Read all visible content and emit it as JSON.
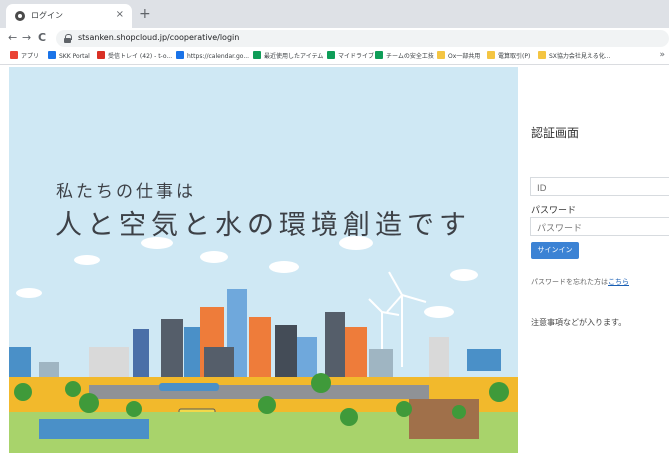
{
  "tab": {
    "title": "ログイン",
    "close": "×",
    "new_tab": "+"
  },
  "toolbar": {
    "back": "←",
    "forward": "→",
    "reload": "C",
    "url": "stsanken.shopcloud.jp/cooperative/login"
  },
  "bookmarks": [
    {
      "label": "アプリ",
      "icon": "apps-grid-icon",
      "color": "#ea4335"
    },
    {
      "label": "SKK Portal",
      "icon": "portal-icon",
      "color": "#1a73e8"
    },
    {
      "label": "受信トレイ (42) - t-o...",
      "icon": "gmail-icon",
      "color": "#d93025"
    },
    {
      "label": "https://calendar.go...",
      "icon": "calendar-icon",
      "color": "#1a73e8"
    },
    {
      "label": "最近使用したアイテム",
      "icon": "drive-icon",
      "color": "#0f9d58"
    },
    {
      "label": "マイドライブ",
      "icon": "drive-icon",
      "color": "#0f9d58"
    },
    {
      "label": "チームの安全工技",
      "icon": "drive-icon",
      "color": "#0f9d58"
    },
    {
      "label": "Ox一部共用",
      "icon": "folder-icon",
      "color": "#f4c542"
    },
    {
      "label": "電算取引(P)",
      "icon": "folder-icon",
      "color": "#f4c542"
    },
    {
      "label": "SX協力会社見える化...",
      "icon": "folder-icon",
      "color": "#f4c542"
    }
  ],
  "bookmarks_more": "»",
  "hero": {
    "tagline_1": "私たちの仕事は",
    "tagline_2": "人と空気と水の環境創造です"
  },
  "login": {
    "title": "認証画面",
    "id_placeholder": "ID",
    "password_label": "パスワード",
    "password_placeholder": "パスワード",
    "signin_label": "サインイン",
    "forgot_text": "パスワードを忘れた方は",
    "forgot_link": "こちら",
    "notice": "注意事項などが入ります。"
  },
  "colors": {
    "accent": "#3b82d4",
    "hero_bg": "#cfe8f4",
    "link": "#1a5fb4"
  }
}
